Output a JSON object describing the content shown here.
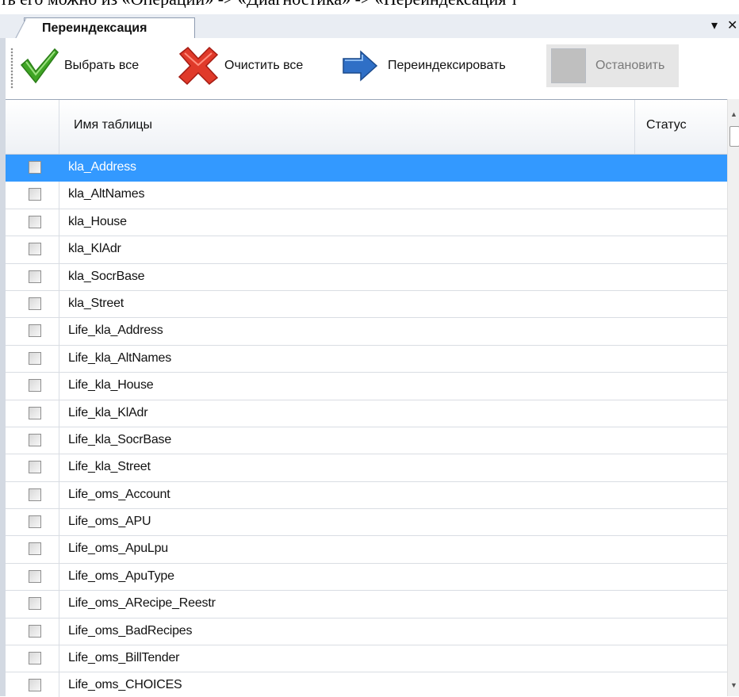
{
  "caption": "ть его можно из «Операции» -> «Диагностика» -> «Переиндексация т",
  "panel": {
    "tab_title": "Переиндексация",
    "pin_glyph": "▾",
    "close_glyph": "✕"
  },
  "toolbar": {
    "select_all": "Выбрать все",
    "clear_all": "Очистить все",
    "reindex": "Переиндексировать",
    "stop": "Остановить"
  },
  "grid": {
    "columns": {
      "name": "Имя таблицы",
      "status": "Статус"
    },
    "selected_index": 0,
    "rows": [
      {
        "name": "kla_Address",
        "checked": false
      },
      {
        "name": "kla_AltNames",
        "checked": false
      },
      {
        "name": "kla_House",
        "checked": false
      },
      {
        "name": "kla_KlAdr",
        "checked": false
      },
      {
        "name": "kla_SocrBase",
        "checked": false
      },
      {
        "name": "kla_Street",
        "checked": false
      },
      {
        "name": "Life_kla_Address",
        "checked": false
      },
      {
        "name": "Life_kla_AltNames",
        "checked": false
      },
      {
        "name": "Life_kla_House",
        "checked": false
      },
      {
        "name": "Life_kla_KlAdr",
        "checked": false
      },
      {
        "name": "Life_kla_SocrBase",
        "checked": false
      },
      {
        "name": "Life_kla_Street",
        "checked": false
      },
      {
        "name": "Life_oms_Account",
        "checked": false
      },
      {
        "name": "Life_oms_APU",
        "checked": false
      },
      {
        "name": "Life_oms_ApuLpu",
        "checked": false
      },
      {
        "name": "Life_oms_ApuType",
        "checked": false
      },
      {
        "name": "Life_oms_ARecipe_Reestr",
        "checked": false
      },
      {
        "name": "Life_oms_BadRecipes",
        "checked": false
      },
      {
        "name": "Life_oms_BillTender",
        "checked": false
      },
      {
        "name": "Life_oms_CHOICES",
        "checked": false
      }
    ]
  },
  "colors": {
    "selection": "#3399ff",
    "check_green": "#3fa525",
    "cross_red": "#e03a2a",
    "arrow_blue": "#2f6fc6"
  }
}
